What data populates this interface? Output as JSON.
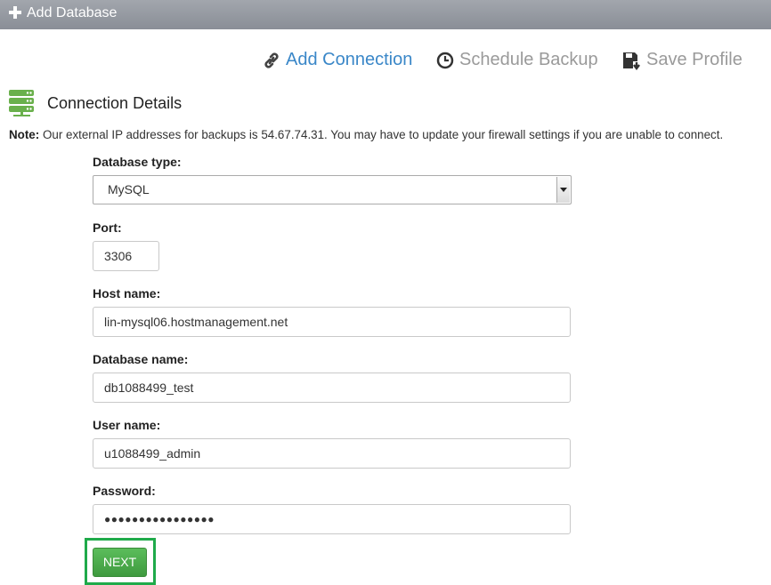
{
  "header": {
    "title": "Add Database"
  },
  "steps": [
    {
      "label": "Add Connection",
      "icon": "link-icon",
      "state": "active"
    },
    {
      "label": "Schedule Backup",
      "icon": "clock-icon",
      "state": "inactive"
    },
    {
      "label": "Save Profile",
      "icon": "save-icon",
      "state": "inactive"
    }
  ],
  "section": {
    "title": "Connection Details",
    "icon": "database-server-icon"
  },
  "note": {
    "label": "Note:",
    "text": "Our external IP addresses for backups is 54.67.74.31. You may have to update your firewall settings if you are unable to connect."
  },
  "form": {
    "database_type": {
      "label": "Database type:",
      "value": "MySQL"
    },
    "port": {
      "label": "Port:",
      "value": "3306"
    },
    "host_name": {
      "label": "Host name:",
      "value": "lin-mysql06.hostmanagement.net"
    },
    "database_name": {
      "label": "Database name:",
      "value": "db1088499_test"
    },
    "user_name": {
      "label": "User name:",
      "value": "u1088499_admin"
    },
    "password": {
      "label": "Password:",
      "value": "●●●●●●●●●●●●●●●●"
    }
  },
  "actions": {
    "next_label": "NEXT"
  },
  "colors": {
    "accent": "#3a87c8",
    "inactive": "#9a9a9a",
    "button": "#4cae4c",
    "highlight": "#1faa4a",
    "icon_green": "#6ab04c"
  }
}
